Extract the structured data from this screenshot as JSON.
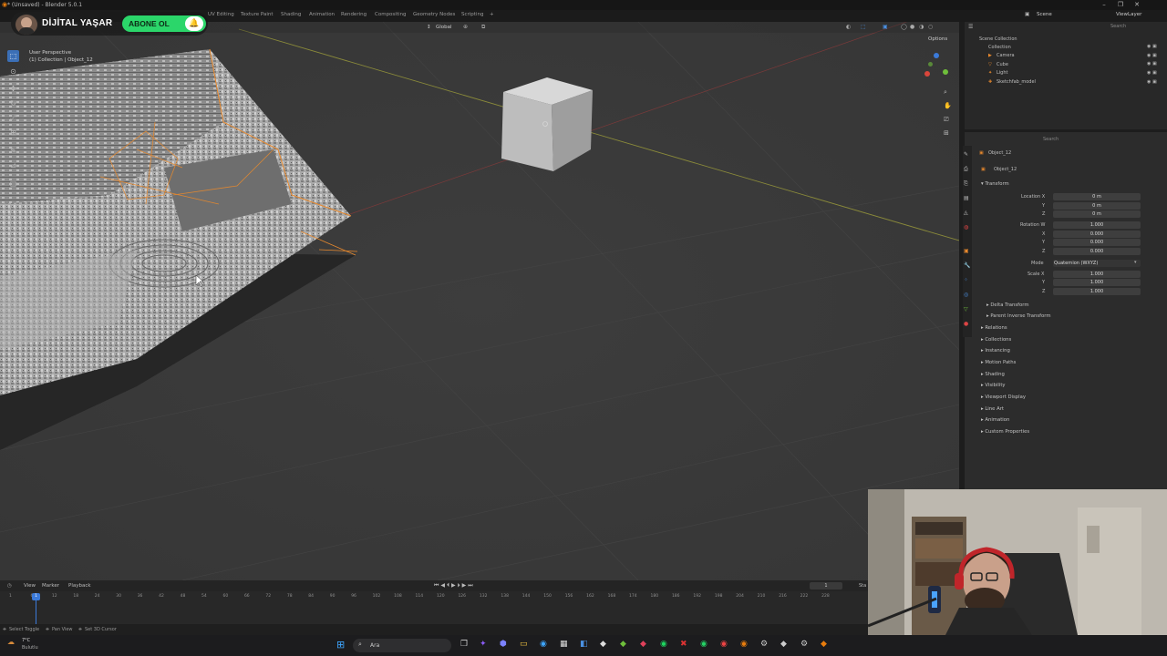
{
  "window": {
    "title": "* (Unsaved) - Blender 5.0.1"
  },
  "workspace_tabs": [
    "UV Editing",
    "Texture Paint",
    "Shading",
    "Animation",
    "Rendering",
    "Compositing",
    "Geometry Nodes",
    "Scripting",
    "+"
  ],
  "channel": {
    "name": "DİJİTAL YAŞAR",
    "subscribe_label": "ABONE OL",
    "bell_icon": "bell-icon",
    "subscribe_color": "#2bd66a"
  },
  "viewport": {
    "orientation": "Global",
    "options_label": "Options",
    "info_line1": "User Perspective",
    "info_line2": "(1) Collection | Object_12",
    "gizmo_axes": [
      "X",
      "Y",
      "Z"
    ],
    "selection_color": "#e8892d"
  },
  "outliner": {
    "header_label": "Scene",
    "view_layer_label": "ViewLayer",
    "search_placeholder": "Search",
    "items": [
      {
        "label": "Scene Collection"
      },
      {
        "label": "Collection"
      },
      {
        "label": "Camera"
      },
      {
        "label": "Cube"
      },
      {
        "label": "Light"
      },
      {
        "label": "Sketchfab_model"
      }
    ]
  },
  "properties": {
    "search_placeholder": "Search",
    "object_name": "Object_12",
    "object_field": "Object_12",
    "transform_label": "Transform",
    "rows": [
      {
        "label": "Location X",
        "value": "0 m"
      },
      {
        "label": "Y",
        "value": "0 m"
      },
      {
        "label": "Z",
        "value": "0 m"
      },
      {
        "label": "Rotation W",
        "value": "1.000"
      },
      {
        "label": "X",
        "value": "0.000"
      },
      {
        "label": "Y",
        "value": "0.000"
      },
      {
        "label": "Z",
        "value": "0.000"
      }
    ],
    "mode_label": "Mode",
    "mode_value": "Quaternion (WXYZ)",
    "scale_rows": [
      {
        "label": "Scale X",
        "value": "1.000"
      },
      {
        "label": "Y",
        "value": "1.000"
      },
      {
        "label": "Z",
        "value": "1.000"
      }
    ],
    "subsections": [
      "Delta Transform",
      "Parent Inverse Transform"
    ],
    "sections": [
      "Relations",
      "Collections",
      "Instancing",
      "Motion Paths",
      "Shading",
      "Visibility",
      "Viewport Display",
      "Line Art",
      "Animation",
      "Custom Properties"
    ]
  },
  "timeline": {
    "menus": [
      "View",
      "Marker",
      "Playback"
    ],
    "current_frame": "1",
    "start_label": "Sta",
    "ticks": [
      "1",
      "6",
      "12",
      "18",
      "24",
      "30",
      "36",
      "42",
      "48",
      "54",
      "60",
      "66",
      "72",
      "78",
      "84",
      "90",
      "96",
      "102",
      "108",
      "114",
      "120",
      "126",
      "132",
      "138",
      "144",
      "150",
      "156",
      "162",
      "168",
      "174",
      "180",
      "186",
      "192",
      "198",
      "204",
      "210",
      "216",
      "222",
      "228"
    ]
  },
  "statusbar": {
    "items": [
      "Select Toggle",
      "Pan View",
      "Set 3D Cursor"
    ]
  },
  "taskbar": {
    "search_label": "Ara",
    "weather_temp": "7°C",
    "weather_desc": "Bulutlu"
  }
}
